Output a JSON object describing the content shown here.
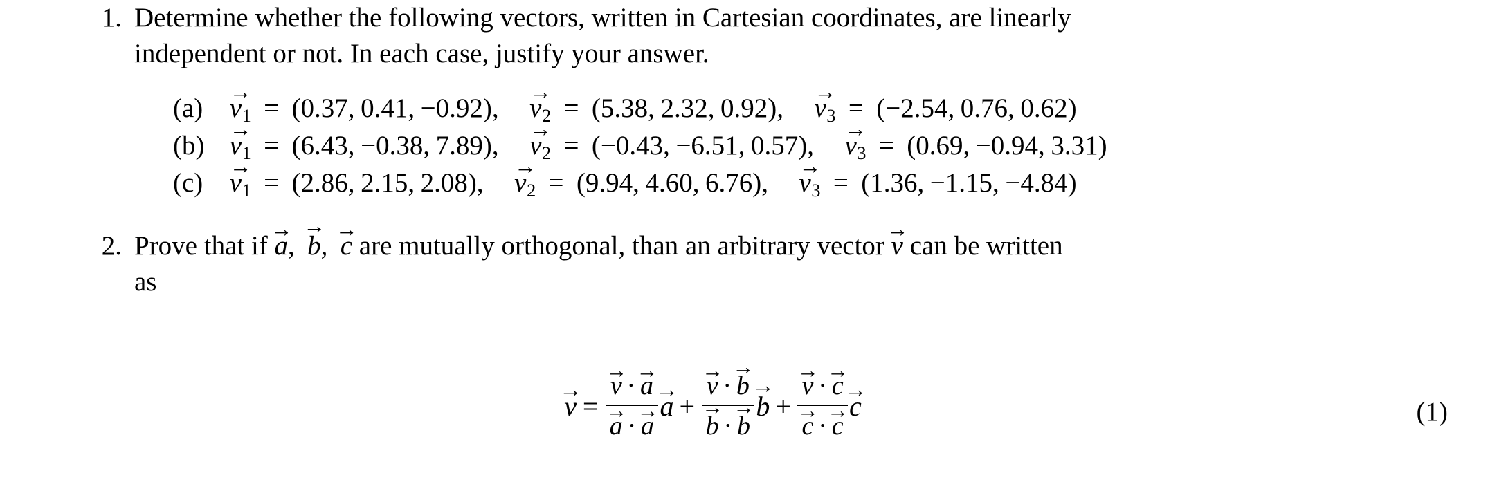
{
  "document": {
    "type": "latex-problem-set",
    "background_color": "#ffffff",
    "text_color": "#000000"
  },
  "problems": [
    {
      "marker": "1.",
      "lines": [
        "Determine whether the following vectors, written in Cartesian coordinates, are linearly",
        "independent or not.  In each case, justify your answer."
      ],
      "subitems": [
        {
          "marker": "(a)",
          "vectors": [
            {
              "name": "v",
              "subscript": "1",
              "components": [
                "0.37",
                "0.41",
                "−0.92"
              ]
            },
            {
              "name": "v",
              "subscript": "2",
              "components": [
                "5.38",
                "2.32",
                "0.92"
              ]
            },
            {
              "name": "v",
              "subscript": "3",
              "components": [
                "−2.54",
                "0.76",
                "0.62"
              ]
            }
          ]
        },
        {
          "marker": "(b)",
          "vectors": [
            {
              "name": "v",
              "subscript": "1",
              "components": [
                "6.43",
                "−0.38",
                "7.89"
              ]
            },
            {
              "name": "v",
              "subscript": "2",
              "components": [
                "−0.43",
                "−6.51",
                "0.57"
              ]
            },
            {
              "name": "v",
              "subscript": "3",
              "components": [
                "0.69",
                "−0.94",
                "3.31"
              ]
            }
          ]
        },
        {
          "marker": "(c)",
          "vectors": [
            {
              "name": "v",
              "subscript": "1",
              "components": [
                "2.86",
                "2.15",
                "2.08"
              ]
            },
            {
              "name": "v",
              "subscript": "2",
              "components": [
                "9.94",
                "4.60",
                "6.76"
              ]
            },
            {
              "name": "v",
              "subscript": "3",
              "components": [
                "1.36",
                "−1.15",
                "−4.84"
              ]
            }
          ]
        }
      ]
    },
    {
      "marker": "2.",
      "text_parts": {
        "before_a": "Prove that if",
        "after_c": "are mutually orthogonal, than an arbitrary vector",
        "after_v": "can be written",
        "line2": "as"
      },
      "symbols": {
        "a": "a",
        "b": "b",
        "c": "c",
        "v": "v"
      }
    }
  ],
  "display_equation": {
    "lhs": "v",
    "equals": "=",
    "plus": "+",
    "dot": "·",
    "number": "(1)",
    "terms": [
      {
        "numerator": [
          "v",
          "a"
        ],
        "denominator": [
          "a",
          "a"
        ],
        "multiplier": "a"
      },
      {
        "numerator": [
          "v",
          "b"
        ],
        "denominator": [
          "b",
          "b"
        ],
        "multiplier": "b"
      },
      {
        "numerator": [
          "v",
          "c"
        ],
        "denominator": [
          "c",
          "c"
        ],
        "multiplier": "c"
      }
    ]
  },
  "glyphs": {
    "vector_arrow": "→",
    "lparen": "(",
    "rparen": ")",
    "comma": ",",
    "equals": "=",
    "plus": "+",
    "cdot": "·"
  }
}
